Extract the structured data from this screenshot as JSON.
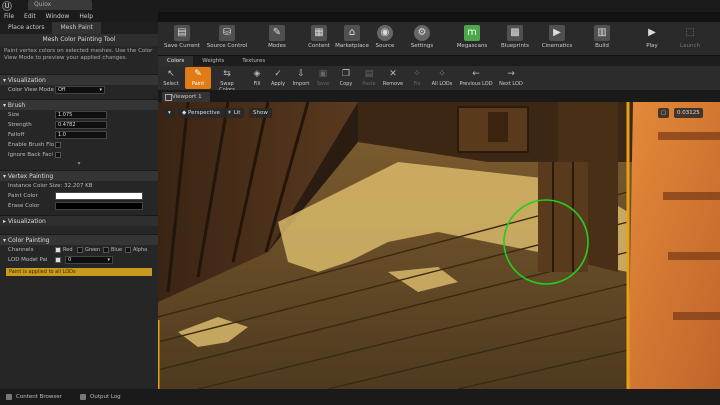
{
  "window": {
    "logo_glyph": "U",
    "tab_label": "Quiox"
  },
  "menu": [
    "File",
    "Edit",
    "Window",
    "Help"
  ],
  "modes": {
    "tabs": [
      "Place actors",
      "Mesh Paint"
    ],
    "active": 1
  },
  "panel": {
    "title": "Mesh Color Painting Tool",
    "description": "Paint vertex colors on selected meshes.  Use the Color View Mode to preview your applied changes.",
    "visualization": {
      "header": "Visualization",
      "color_view_mode_label": "Color View Mode",
      "color_view_mode_value": "Off"
    },
    "brush": {
      "header": "Brush",
      "size_label": "Size",
      "size_value": "1.075",
      "strength_label": "Strength",
      "strength_value": "0.4782",
      "falloff_label": "Falloff",
      "falloff_value": "1.0",
      "enable_brush_flow_label": "Enable Brush Flo",
      "ignore_back_facing_label": "Ignore Back Faci"
    },
    "vertex_painting": {
      "header": "Vertex Painting",
      "instance_color_size": "Instance Color Size: 32.207 KB",
      "paint_color_label": "Paint Color",
      "erase_color_label": "Erase Color",
      "paint_color": "#ffffff",
      "erase_color": "#000000",
      "visualization_label": "Visualization"
    },
    "color_painting": {
      "header": "Color Painting",
      "channels_label": "Channels",
      "channels": [
        {
          "name": "Red",
          "checked": true
        },
        {
          "name": "Green",
          "checked": false
        },
        {
          "name": "Blue",
          "checked": false
        },
        {
          "name": "Alpha",
          "checked": false
        }
      ],
      "lod_model_label": "LOD Model Pai",
      "lod_model_value": "0",
      "warning": "Paint is applied to all LODs"
    }
  },
  "bottom_tabs": [
    "Content Browser",
    "Output Log"
  ],
  "toolbar": {
    "buttons": [
      {
        "label": "Save Current",
        "icon": "save-icon"
      },
      {
        "label": "Source Control",
        "icon": "source-control-icon"
      },
      {
        "label": "Modes",
        "icon": "modes-icon"
      },
      {
        "label": "Content",
        "icon": "content-icon"
      },
      {
        "label": "Marketplace",
        "icon": "marketplace-icon"
      },
      {
        "label": "Source",
        "icon": "source-icon"
      },
      {
        "label": "Settings",
        "icon": "settings-icon"
      },
      {
        "label": "Megascans",
        "icon": "megascans-icon"
      },
      {
        "label": "Blueprints",
        "icon": "blueprints-icon"
      },
      {
        "label": "Cinematics",
        "icon": "cinematics-icon"
      },
      {
        "label": "Build",
        "icon": "build-icon"
      },
      {
        "label": "Play",
        "icon": "play-icon"
      },
      {
        "label": "Launch",
        "icon": "launch-icon"
      }
    ]
  },
  "paint_tabs": [
    "Colors",
    "Weights",
    "Textures"
  ],
  "paint_tools": [
    {
      "label": "Select",
      "glyph": "↖",
      "state": "normal"
    },
    {
      "label": "Paint",
      "glyph": "✎",
      "state": "active"
    },
    {
      "label": "Swap Colors",
      "glyph": "⇆",
      "state": "normal"
    },
    {
      "label": "Fill",
      "glyph": "◈",
      "state": "normal"
    },
    {
      "label": "Apply",
      "glyph": "✓",
      "state": "normal"
    },
    {
      "label": "Import",
      "glyph": "⇩",
      "state": "normal"
    },
    {
      "label": "Save",
      "glyph": "▣",
      "state": "disabled"
    },
    {
      "label": "Copy",
      "glyph": "❐",
      "state": "normal"
    },
    {
      "label": "Paste",
      "glyph": "▤",
      "state": "disabled"
    },
    {
      "label": "Remove",
      "glyph": "✕",
      "state": "normal"
    },
    {
      "label": "Fix",
      "glyph": "✧",
      "state": "disabled"
    },
    {
      "label": "All LODs",
      "glyph": "⁘",
      "state": "normal"
    },
    {
      "label": "Previous LOD",
      "glyph": "←",
      "state": "normal"
    },
    {
      "label": "Next LOD",
      "glyph": "→",
      "state": "normal"
    }
  ],
  "viewport": {
    "tab_label": "Viewport 1",
    "perspective_label": "Perspective",
    "lit_label": "Lit",
    "show_label": "Show",
    "right_value": "0.03125"
  },
  "colors": {
    "accent": "#e07b16",
    "brush_circle": "#1fd01f"
  }
}
